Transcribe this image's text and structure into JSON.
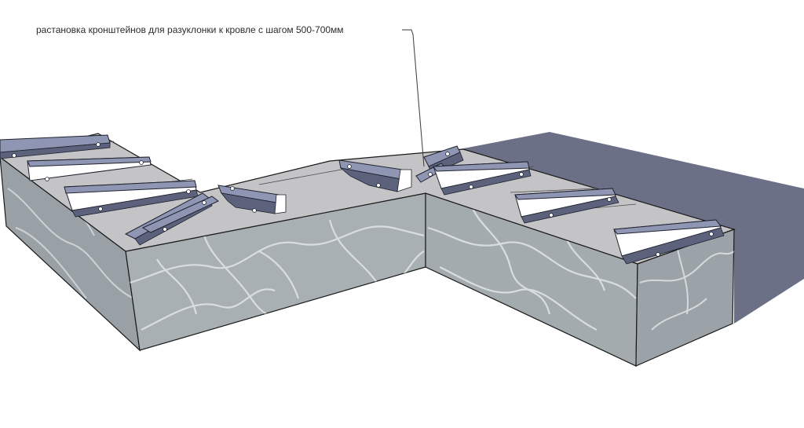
{
  "annotation": {
    "text": "растановка кронштейнов для разуклонки к кровле с шагом 500-700мм"
  },
  "scene": {
    "colors": {
      "roof": "#c4c4c6",
      "wall": "#a7aeb2",
      "marble_vein": "#dfe4e6",
      "shadow": "#6c7087",
      "bracket_top": "#8f96b4",
      "bracket_side": "#ffffff",
      "bracket_edge": "#20222e",
      "leader": "#3a3a3a"
    },
    "icons": [
      "bracket",
      "leader-line"
    ]
  }
}
